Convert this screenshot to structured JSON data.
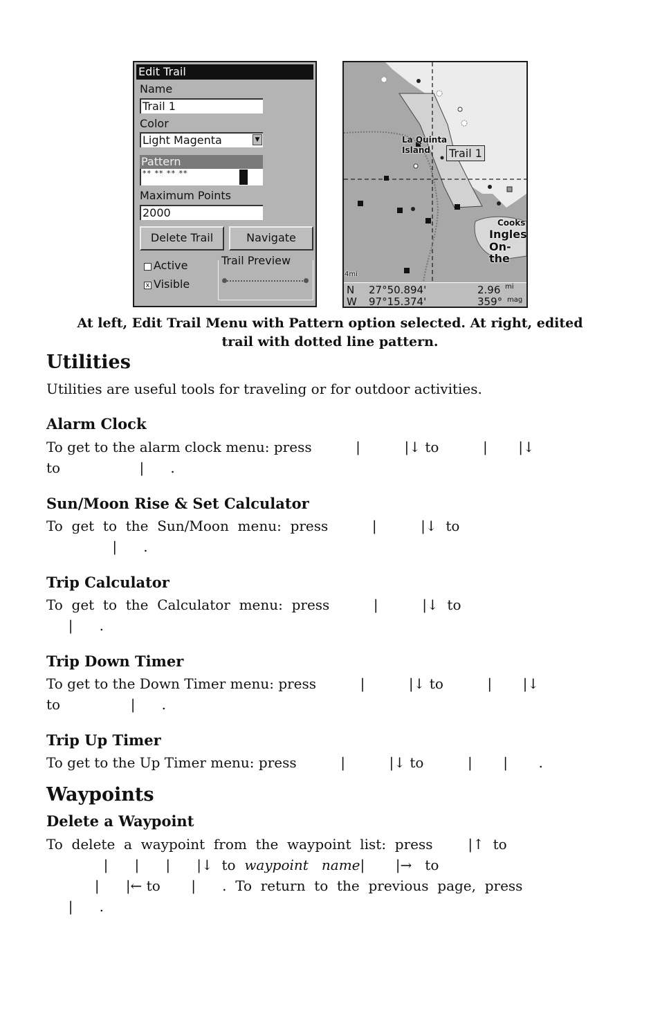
{
  "edit_trail": {
    "title": "Edit Trail",
    "name_label": "Name",
    "name_value": "Trail 1",
    "color_label": "Color",
    "color_value": "Light Magenta",
    "pattern_label": "Pattern",
    "pattern_value": "**   **   **   **",
    "max_points_label": "Maximum Points",
    "max_points_value": "2000",
    "delete_button": "Delete Trail",
    "navigate_button": "Navigate",
    "active_label": "Active",
    "active_checked": false,
    "visible_label": "Visible",
    "visible_checked": true,
    "visible_mark": "x",
    "preview_label": "Trail Preview"
  },
  "map": {
    "trail_label": "Trail 1",
    "places": [
      "La Quinta",
      "Island",
      "Cooks",
      "Inglesi",
      "On-the"
    ],
    "scale": "4mi",
    "lat_hemi": "N",
    "lat": "27°50.894'",
    "lon_hemi": "W",
    "lon": "97°15.374'",
    "distance": "2.96",
    "distance_unit": "mi",
    "bearing": "359°",
    "bearing_unit": "mag"
  },
  "caption": {
    "line1": "At left, Edit Trail Menu with Pattern option selected. At right, edited",
    "line2": "trail with dotted line pattern."
  },
  "utilities": {
    "heading": "Utilities",
    "intro": "Utilities are useful tools for traveling or for outdoor activities.",
    "alarm": {
      "heading": "Alarm Clock",
      "line1": "To get to the alarm clock menu: press          |          |↓ to          |       |↓",
      "line2": "to                  |      ."
    },
    "sunmoon": {
      "heading": "Sun/Moon Rise & Set Calculator",
      "line1": "To  get  to  the  Sun/Moon  menu:  press          |          |↓  to",
      "line2": "               |      ."
    },
    "calculator": {
      "heading": "Trip Calculator",
      "line1": "To  get  to  the  Calculator  menu:  press          |          |↓  to",
      "line2": "     |      ."
    },
    "down_timer": {
      "heading": "Trip Down Timer",
      "line1": "To get to the Down Timer menu: press          |          |↓ to          |       |↓",
      "line2": "to                |      ."
    },
    "up_timer": {
      "heading": "Trip Up Timer",
      "line1": "To get to the Up Timer menu: press          |          |↓ to          |       |       ."
    }
  },
  "waypoints": {
    "heading": "Waypoints",
    "delete": {
      "heading": "Delete a Waypoint",
      "line1": "To  delete  a  waypoint  from  the  waypoint  list:  press        |↑  to",
      "line2a": "             |      |      |      |↓  to  ",
      "line2_italic": "waypoint   name",
      "line2b": "|       |→   to",
      "line3": "           |      |← to       |      .  To  return  to  the  previous  page,  press",
      "line4": "     |      ."
    }
  }
}
